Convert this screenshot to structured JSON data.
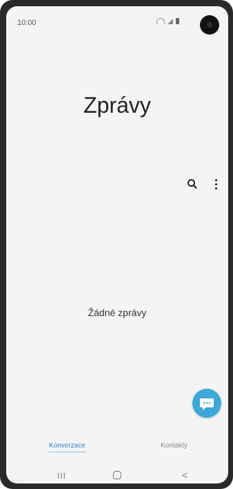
{
  "status_bar": {
    "time": "10:00"
  },
  "header": {
    "title": "Zprávy"
  },
  "main": {
    "empty_message": "Žádné zprávy"
  },
  "tabs": [
    {
      "label": "Konverzace"
    },
    {
      "label": "Kontakty"
    }
  ],
  "colors": {
    "accent": "#3b7fd4",
    "fab": "#3da9d8",
    "background": "#f4f4f4"
  },
  "icons": {
    "search": "search-icon",
    "more": "more-vert-icon",
    "fab": "new-message-icon",
    "nav_recent": "recent-apps-icon",
    "nav_home": "home-icon",
    "nav_back": "back-icon"
  },
  "nav": {
    "recent_glyph": "III",
    "back_glyph": "<"
  }
}
